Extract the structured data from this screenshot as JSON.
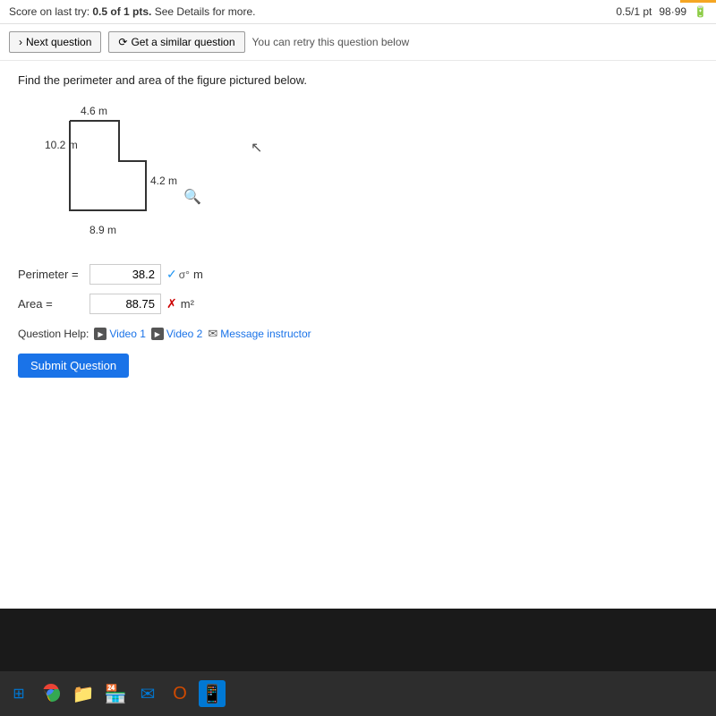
{
  "topbar": {
    "score_text": "Score on last try: ",
    "score_value": "0.5 of 1 pts.",
    "score_suffix": " See Details for more.",
    "top_right": {
      "pts": "0.5/1 pt",
      "score": "98·99",
      "battery": "99"
    }
  },
  "toolbar": {
    "next_label": "Next question",
    "similar_label": "Get a similar question",
    "retry_text": "You can retry this question below"
  },
  "question": {
    "text": "Find the perimeter and area of the figure pictured below.",
    "figure": {
      "label_top": "4.6 m",
      "label_left": "10.2 m",
      "label_right": "4.2 m",
      "label_bottom": "8.9 m"
    },
    "perimeter": {
      "label": "Perimeter =",
      "value": "38.2",
      "status": "correct",
      "unit": "m"
    },
    "area": {
      "label": "Area =",
      "value": "88.75",
      "status": "incorrect",
      "unit": "m²"
    },
    "help": {
      "label": "Question Help:",
      "video1": "Video 1",
      "video2": "Video 2",
      "message": "Message instructor"
    },
    "submit_label": "Submit Question"
  },
  "taskbar": {
    "icons": [
      "⊞",
      "G",
      "🗂",
      "🏪",
      "✉",
      "O",
      "📱"
    ]
  }
}
